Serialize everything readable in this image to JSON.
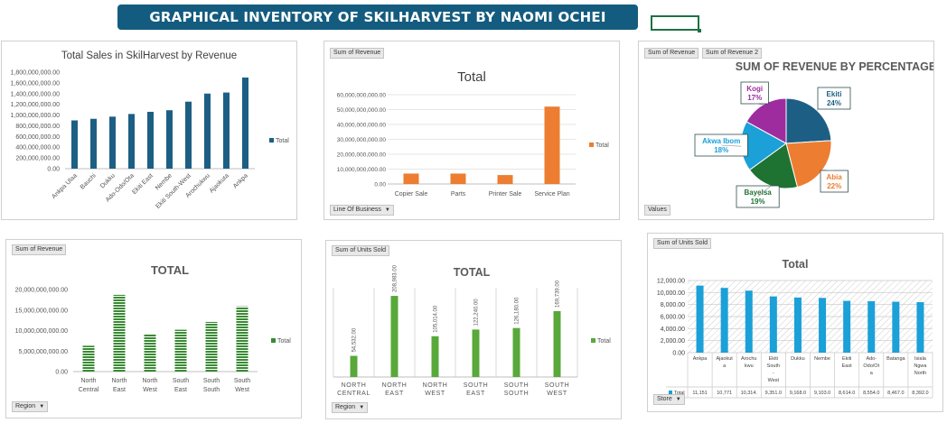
{
  "banner": {
    "title": "GRAPHICAL INVENTORY OF SKILHARVEST BY NAOMI OCHEI"
  },
  "colors": {
    "banner": "#145c7f",
    "blue": "#1d5f84",
    "orange": "#ed7d31",
    "green_stripe": "#3a8a34",
    "green": "#58a83a",
    "cyan": "#1ba0d8",
    "pie_blue": "#1d5f84",
    "pie_orange": "#ed7d31",
    "pie_green": "#1e7332",
    "pie_cyan": "#1ba0d8",
    "pie_purple": "#9e2c9f"
  },
  "panel1": {
    "chart_data": {
      "type": "bar",
      "title": "Total Sales in SkilHarvest by Revenue",
      "categories": [
        "Ankpa Ulaa",
        "Bauchi",
        "Dukku",
        "Ado-Odo/Ota",
        "Ekiti East",
        "Nembe",
        "Ekiti South-West",
        "Arochukwu",
        "Ajaokuta",
        "Ankpa"
      ],
      "series": [
        {
          "name": "Total",
          "values": [
            900000000,
            930000000,
            970000000,
            1020000000,
            1060000000,
            1090000000,
            1250000000,
            1400000000,
            1420000000,
            1700000000
          ]
        }
      ],
      "ylim": [
        0,
        1800000000
      ],
      "yticks": [
        "0.00",
        "200,000,000.00",
        "400,000,000.00",
        "600,000,000.00",
        "800,000,000.00",
        "1,000,000,000.00",
        "1,200,000,000.00",
        "1,400,000,000.00",
        "1,600,000,000.00",
        "1,800,000,000.00"
      ],
      "legend": "right"
    }
  },
  "panel2": {
    "button_top": "Sum of Revenue",
    "button_bottom": "Line Of Business",
    "chart_data": {
      "type": "bar",
      "title": "Total",
      "categories": [
        "Copier Sale",
        "Parts",
        "Printer Sale",
        "Service Plan"
      ],
      "series": [
        {
          "name": "Total",
          "values": [
            7000000000,
            7000000000,
            6000000000,
            52000000000
          ]
        }
      ],
      "ylim": [
        0,
        60000000000
      ],
      "yticks": [
        "0.00",
        "10,000,000,000.00",
        "20,000,000,000.00",
        "30,000,000,000.00",
        "40,000,000,000.00",
        "50,000,000,000.00",
        "60,000,000,000.00"
      ],
      "legend": "right"
    }
  },
  "panel3": {
    "button_a": "Sum of Revenue",
    "button_b": "Sum of Revenue 2",
    "button_bottom": "Values",
    "chart_data": {
      "type": "pie",
      "title": "SUM OF REVENUE BY PERCENTAGE",
      "slices": [
        {
          "label": "Ekiti",
          "pct": "24%",
          "value": 24
        },
        {
          "label": "Abia",
          "pct": "22%",
          "value": 22
        },
        {
          "label": "Bayelsa",
          "pct": "19%",
          "value": 19
        },
        {
          "label": "Akwa Ibom",
          "pct": "18%",
          "value": 18
        },
        {
          "label": "Kogi",
          "pct": "17%",
          "value": 17
        }
      ]
    }
  },
  "panel4": {
    "button_top": "Sum of Revenue",
    "button_bottom": "Region",
    "chart_data": {
      "type": "bar",
      "title": "TOTAL",
      "categories": [
        "North Central",
        "North East",
        "North West",
        "South East",
        "South South",
        "South West"
      ],
      "series": [
        {
          "name": "Total",
          "values": [
            6300000000,
            18700000000,
            9200000000,
            10200000000,
            12100000000,
            15900000000
          ]
        }
      ],
      "ylim": [
        0,
        20000000000
      ],
      "yticks": [
        "0.00",
        "5,000,000,000.00",
        "10,000,000,000.00",
        "15,000,000,000.00",
        "20,000,000,000.00"
      ],
      "legend": "right"
    }
  },
  "panel5": {
    "button_top": "Sum of Units Sold",
    "button_bottom": "Region",
    "chart_data": {
      "type": "bar",
      "title": "TOTAL",
      "categories": [
        "NORTH CENTRAL",
        "NORTH EAST",
        "NORTH WEST",
        "SOUTH EAST",
        "SOUTH SOUTH",
        "SOUTH WEST"
      ],
      "series": [
        {
          "name": "Total",
          "values": [
            54532,
            208983,
            105014,
            122240,
            126180,
            169739
          ]
        }
      ],
      "data_labels": [
        "54,532.00",
        "208,983.00",
        "105,014.00",
        "122,240.00",
        "126,180.00",
        "169,739.00"
      ],
      "ylim": [
        0,
        230000
      ],
      "legend": "right"
    }
  },
  "panel6": {
    "button_top": "Sum of Units Sold",
    "button_bottom": "Store",
    "chart_data": {
      "type": "bar",
      "title": "Total",
      "categories": [
        "Ankpa",
        "Ajaokuta",
        "Arochukwu",
        "Ekiti South-West",
        "Dukku",
        "Nembe",
        "Ekiti East",
        "Ado-Odo/Ota",
        "Batanga",
        "Isiala Ngwa North"
      ],
      "category_lines": [
        [
          "Ankpa"
        ],
        [
          "Ajaokut",
          "a"
        ],
        [
          "Arochu",
          "kwu"
        ],
        [
          "Ekiti",
          "South",
          "-",
          "West"
        ],
        [
          "Dukku"
        ],
        [
          "Nembe"
        ],
        [
          "Ekiti",
          "East"
        ],
        [
          "Ado-",
          "Odo/Ot",
          "a"
        ],
        [
          "Batanga"
        ],
        [
          "Isiala",
          "Ngwa",
          "North"
        ]
      ],
      "series": [
        {
          "name": "Total",
          "values": [
            11151,
            10771,
            10314,
            9351,
            9168,
            9103,
            8614,
            8554,
            8467,
            8392
          ]
        }
      ],
      "table_row": [
        "11,151",
        "10,771",
        "10,314.",
        "9,351.0",
        "9,168.0",
        "9,103.0",
        "8,614.0",
        "8,554.0",
        "8,467.0",
        "8,392.0"
      ],
      "ylim": [
        0,
        12000
      ],
      "yticks": [
        "0.00",
        "2,000.00",
        "4,000.00",
        "6,000.00",
        "8,000.00",
        "10,000.00",
        "12,000.00"
      ]
    }
  }
}
